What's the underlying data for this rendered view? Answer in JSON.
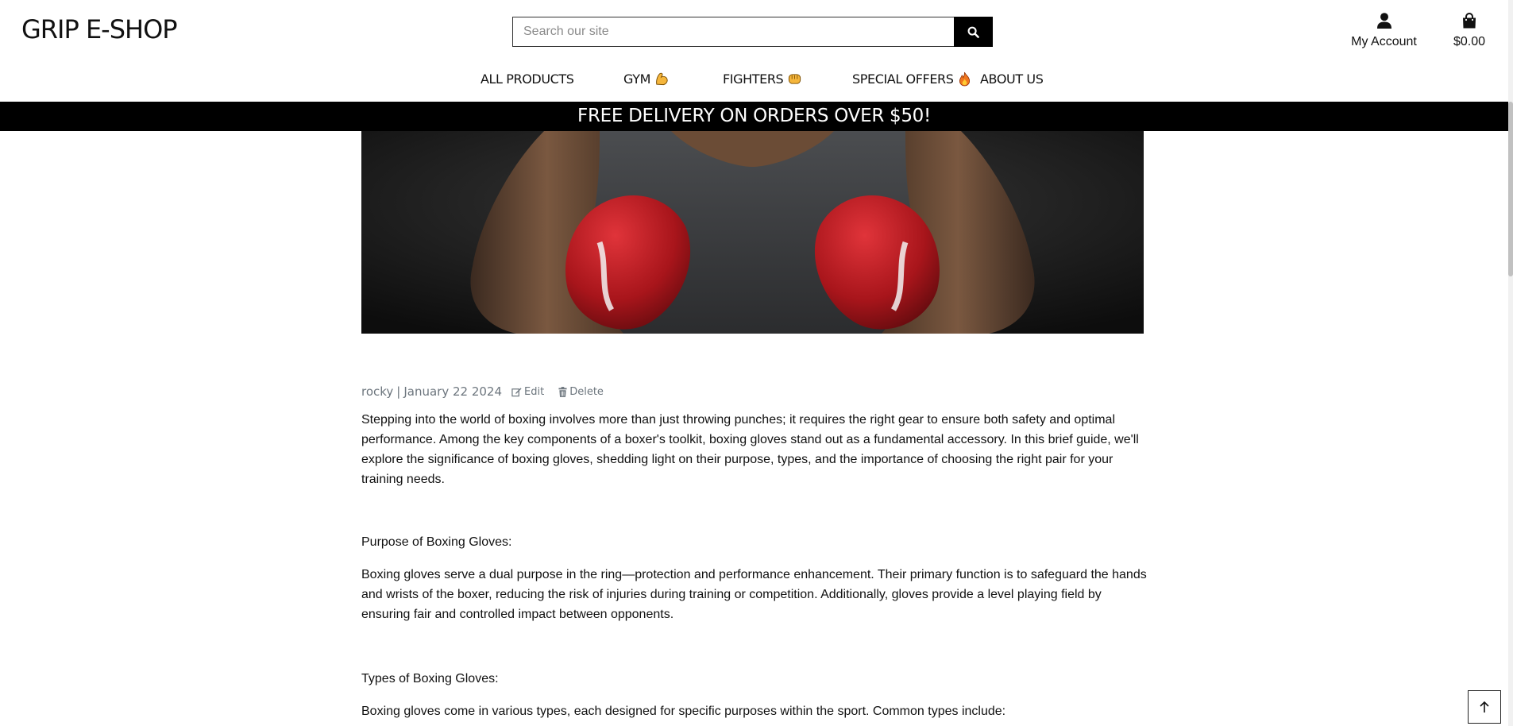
{
  "header": {
    "logo": "GRIP E-SHOP",
    "search": {
      "placeholder": "Search our site",
      "value": ""
    },
    "account_label": "My Account",
    "cart_total": "$0.00",
    "icons": {
      "search": "search-icon",
      "account": "user-icon",
      "cart": "shopping-bag-icon"
    }
  },
  "nav": {
    "items": [
      {
        "label": "ALL PRODUCTS"
      },
      {
        "label": "GYM",
        "emoji": "flexed-biceps-icon"
      },
      {
        "label": "FIGHTERS",
        "emoji": "oncoming-fist-icon"
      },
      {
        "label": "SPECIAL OFFERS",
        "emoji": "fire-icon"
      },
      {
        "label": "ABOUT US"
      }
    ]
  },
  "banner": {
    "text": "FREE DELIVERY ON ORDERS OVER $50!"
  },
  "post": {
    "author": "rocky",
    "separator": "|",
    "date": "January 22 2024",
    "edit_label": "Edit",
    "delete_label": "Delete",
    "hero_image": "boxer with red boxing gloves",
    "paragraphs": [
      "Stepping into the world of boxing involves more than just throwing punches; it requires the right gear to ensure both safety and optimal performance. Among the key components of a boxer's toolkit, boxing gloves stand out as a fundamental accessory. In this brief guide, we'll explore the significance of boxing gloves, shedding light on their purpose, types, and the importance of choosing the right pair for your training needs.",
      "Purpose of Boxing Gloves:",
      "Boxing gloves serve a dual purpose in the ring—protection and performance enhancement. Their primary function is to safeguard the hands and wrists of the boxer, reducing the risk of injuries during training or competition. Additionally, gloves provide a level playing field by ensuring fair and controlled impact between opponents.",
      "Types of Boxing Gloves:",
      "Boxing gloves come in various types, each designed for specific purposes within the sport. Common types include:"
    ]
  },
  "colors": {
    "banner_bg": "#000000",
    "text": "#111111",
    "muted": "#6c757d",
    "glove_red": "#b3161c"
  }
}
